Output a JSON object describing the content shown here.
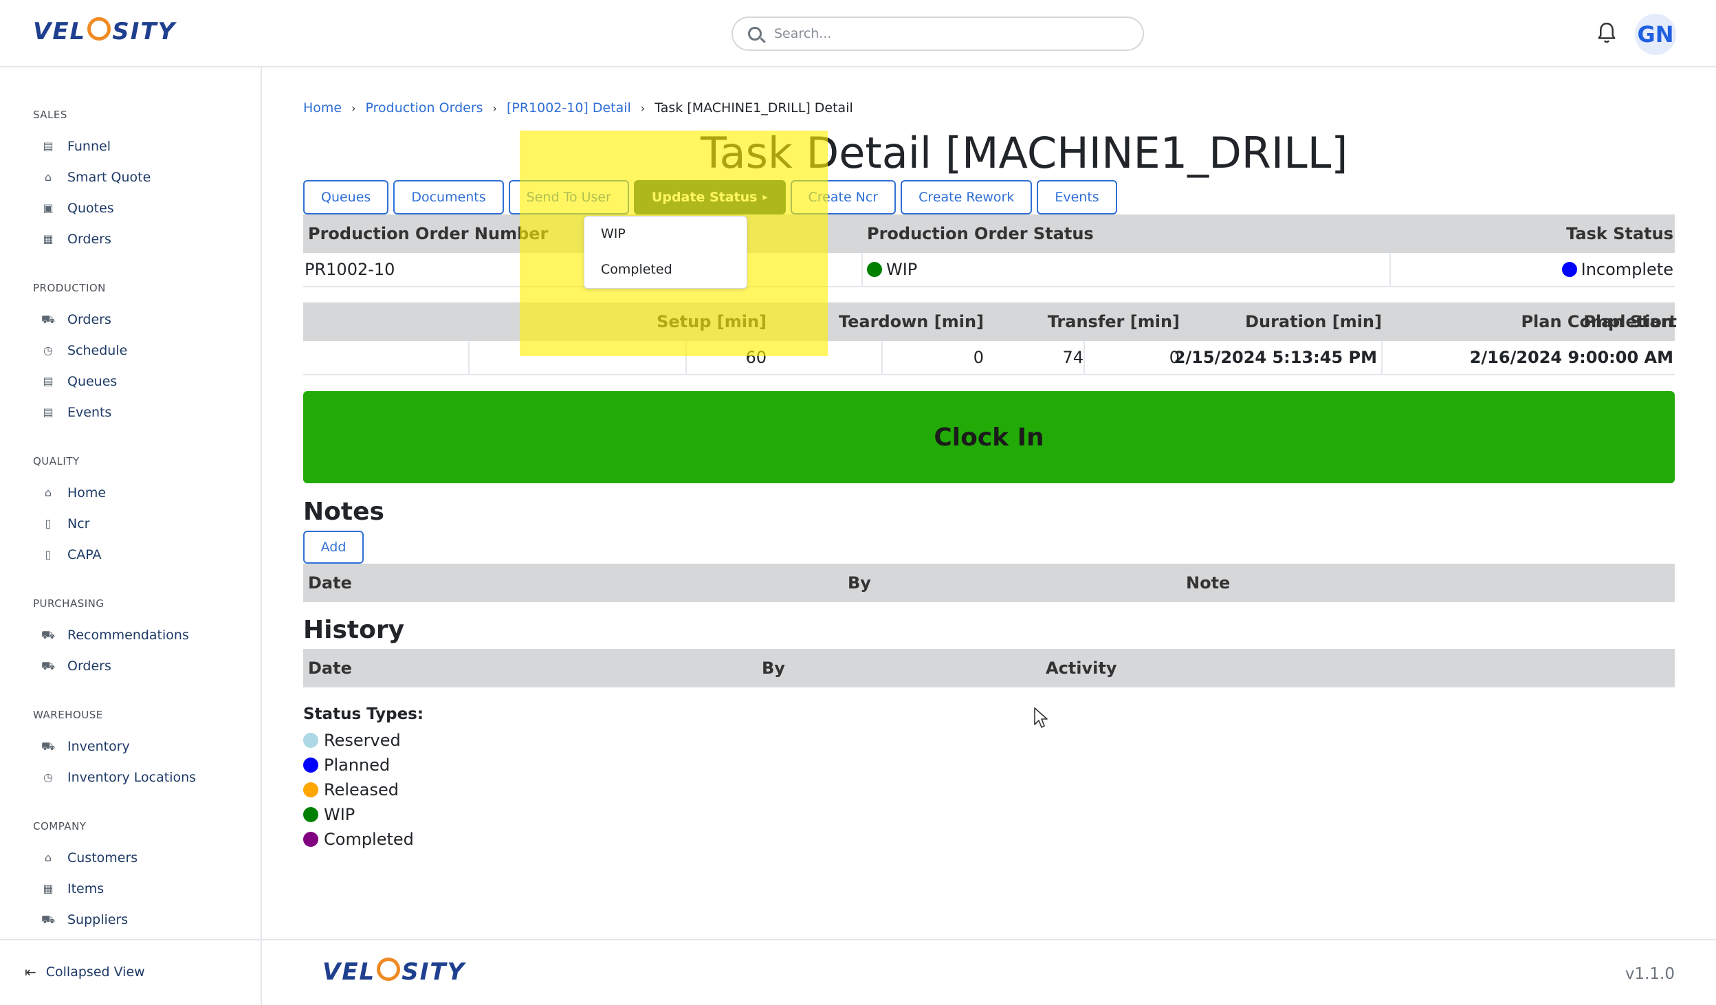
{
  "header": {
    "logo_text": "VELOSITY",
    "search_placeholder": "Search...",
    "avatar_initials": "GN"
  },
  "sidebar": {
    "sections": [
      {
        "title": "SALES",
        "items": [
          {
            "label": "Funnel",
            "icon": "funnel-icon"
          },
          {
            "label": "Smart Quote",
            "icon": "smart-quote-icon"
          },
          {
            "label": "Quotes",
            "icon": "quotes-icon"
          },
          {
            "label": "Orders",
            "icon": "orders-icon"
          }
        ]
      },
      {
        "title": "PRODUCTION",
        "items": [
          {
            "label": "Orders",
            "icon": "cart-icon"
          },
          {
            "label": "Schedule",
            "icon": "clock-icon"
          },
          {
            "label": "Queues",
            "icon": "calendar-icon"
          },
          {
            "label": "Events",
            "icon": "calendar-icon"
          }
        ]
      },
      {
        "title": "QUALITY",
        "items": [
          {
            "label": "Home",
            "icon": "home-icon"
          },
          {
            "label": "Ncr",
            "icon": "document-icon"
          },
          {
            "label": "CAPA",
            "icon": "document-icon"
          }
        ]
      },
      {
        "title": "PURCHASING",
        "items": [
          {
            "label": "Recommendations",
            "icon": "cart-icon"
          },
          {
            "label": "Orders",
            "icon": "cart-icon"
          }
        ]
      },
      {
        "title": "WAREHOUSE",
        "items": [
          {
            "label": "Inventory",
            "icon": "cart-icon"
          },
          {
            "label": "Inventory Locations",
            "icon": "clock-icon"
          }
        ]
      },
      {
        "title": "COMPANY",
        "items": [
          {
            "label": "Customers",
            "icon": "home-icon"
          },
          {
            "label": "Items",
            "icon": "items-icon"
          },
          {
            "label": "Suppliers",
            "icon": "cart-icon"
          }
        ]
      }
    ],
    "collapse_label": "Collapsed View"
  },
  "breadcrumb": {
    "home": "Home",
    "production_orders": "Production Orders",
    "detail": "[PR1002-10] Detail",
    "current": "Task [MACHINE1_DRILL] Detail"
  },
  "page_title": "Task Detail [MACHINE1_DRILL]",
  "toolbar": {
    "queues": "Queues",
    "documents": "Documents",
    "send_to_user": "Send To User",
    "update_status": "Update Status",
    "create_ncr": "Create Ncr",
    "create_rework": "Create Rework",
    "events": "Events"
  },
  "status_dropdown": {
    "options": [
      "WIP",
      "Completed"
    ]
  },
  "order_table": {
    "headers": {
      "order_number": "Production Order Number",
      "order_status": "Production Order Status",
      "task_status": "Task Status"
    },
    "row": {
      "order_number": "PR1002-10",
      "order_status": "WIP",
      "task_status": "Incomplete"
    }
  },
  "timing_table": {
    "headers": {
      "setup": "Setup [min]",
      "teardown": "Teardown [min]",
      "transfer": "Transfer [min]",
      "duration": "Duration [min]",
      "plan_start": "Plan Start",
      "plan_completion": "Plan Completion"
    },
    "row": {
      "setup": "60",
      "teardown": "0",
      "transfer": "0",
      "duration": "74",
      "plan_start": "2/15/2024 5:13:45 PM",
      "plan_completion": "2/16/2024 9:00:00 AM"
    }
  },
  "clock_in_label": "Clock In",
  "notes": {
    "title": "Notes",
    "add_label": "Add",
    "headers": {
      "date": "Date",
      "by": "By",
      "note": "Note"
    }
  },
  "history": {
    "title": "History",
    "headers": {
      "date": "Date",
      "by": "By",
      "activity": "Activity"
    }
  },
  "status_types": {
    "title": "Status Types:",
    "items": [
      {
        "label": "Reserved",
        "color": "#add8e6"
      },
      {
        "label": "Planned",
        "color": "#0000ff"
      },
      {
        "label": "Released",
        "color": "#ffa500"
      },
      {
        "label": "WIP",
        "color": "#008000"
      },
      {
        "label": "Completed",
        "color": "#800080"
      }
    ]
  },
  "colors": {
    "accent": "#2f6fd6",
    "clock_in": "#22aa07",
    "update_status_button": "#2e5e46",
    "wip_dot": "#008000",
    "incomplete_dot": "#0000ff"
  },
  "footer": {
    "version": "v1.1.0"
  }
}
